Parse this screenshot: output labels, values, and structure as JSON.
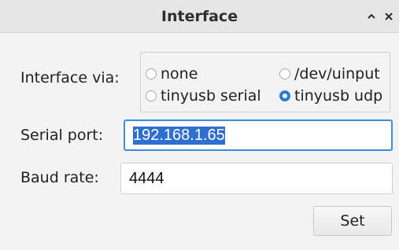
{
  "window": {
    "title": "Interface",
    "shade_icon": "chevron-up-icon",
    "close_icon": "close-icon"
  },
  "interface": {
    "label": "Interface via:",
    "options": [
      {
        "label": "none",
        "selected": false
      },
      {
        "label": "/dev/uinput",
        "selected": false
      },
      {
        "label": "tinyusb serial",
        "selected": false
      },
      {
        "label": "tinyusb udp",
        "selected": true
      }
    ]
  },
  "serial_port": {
    "label": "Serial port:",
    "value": "192.168.1.65"
  },
  "baud_rate": {
    "label": "Baud rate:",
    "value": "4444"
  },
  "set_button": {
    "label": "Set"
  },
  "colors": {
    "accent": "#2f6fd0",
    "focus_border": "#3b8de3",
    "titlebar": "#e6e6e6",
    "background": "#f3f3f3"
  }
}
